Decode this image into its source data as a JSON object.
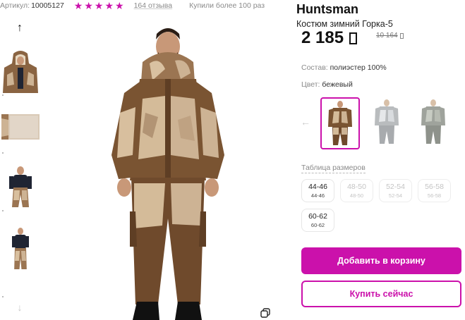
{
  "meta": {
    "sku_label": "Артикул:",
    "sku_value": "10005127",
    "rating_stars": 5,
    "reviews": "164 отзыва",
    "bought": "Купили более 100 раз"
  },
  "gallery": {
    "arrow_up": "↑",
    "arrow_down": "↓",
    "thumbnails": [
      "thumb-hooded-jacket",
      "thumb-lining",
      "thumb-bib-pants",
      "thumb-back-view"
    ]
  },
  "product": {
    "brand": "Huntsman",
    "name": "Костюм зимний Горка-5",
    "price": "2 185",
    "old_price": "10 164"
  },
  "attributes": {
    "composition_label": "Состав:",
    "composition_value": "полиэстер 100%",
    "color_label": "Цвет:",
    "color_value": "бежевый"
  },
  "colors": {
    "prev_arrow": "←",
    "swatches": [
      "brown-camo",
      "white-camo",
      "grey-camo"
    ],
    "selected": 0
  },
  "sizes": {
    "label": "Таблица размеров",
    "items": [
      {
        "size": "44-46",
        "ru": "44-46",
        "available": true
      },
      {
        "size": "48-50",
        "ru": "48-50",
        "available": false
      },
      {
        "size": "52-54",
        "ru": "52-54",
        "available": false
      },
      {
        "size": "56-58",
        "ru": "56-58",
        "available": false
      },
      {
        "size": "60-62",
        "ru": "60-62",
        "available": true
      }
    ]
  },
  "actions": {
    "add_to_cart": "Добавить в корзину",
    "buy_now": "Купить сейчас"
  },
  "colors_theme": {
    "accent": "#cb11ab",
    "camo_brown": "#7a5432",
    "camo_light": "#cdb394"
  }
}
